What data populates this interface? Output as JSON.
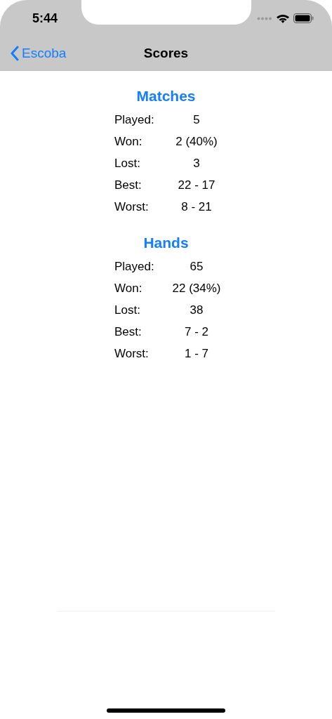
{
  "status_bar": {
    "time": "5:44"
  },
  "nav": {
    "back": "Escoba",
    "title": "Scores"
  },
  "sections": [
    {
      "title": "Matches",
      "rows": [
        {
          "label": "Played:",
          "value": "5"
        },
        {
          "label": "Won:",
          "value": "2 (40%)"
        },
        {
          "label": "Lost:",
          "value": "3"
        },
        {
          "label": "Best:",
          "value": "22 - 17"
        },
        {
          "label": "Worst:",
          "value": "8 - 21"
        }
      ]
    },
    {
      "title": "Hands",
      "rows": [
        {
          "label": "Played:",
          "value": "65"
        },
        {
          "label": "Won:",
          "value": "22 (34%)"
        },
        {
          "label": "Lost:",
          "value": "38"
        },
        {
          "label": "Best:",
          "value": "7 - 2"
        },
        {
          "label": "Worst:",
          "value": "1 - 7"
        }
      ]
    }
  ]
}
